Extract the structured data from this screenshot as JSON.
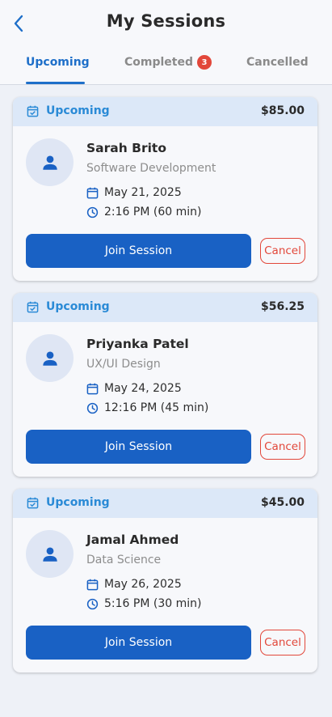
{
  "header": {
    "title": "My Sessions",
    "back_icon": "chevron-left-icon"
  },
  "tabs": [
    {
      "label": "Upcoming",
      "active": true
    },
    {
      "label": "Completed",
      "badge": "3"
    },
    {
      "label": "Cancelled"
    }
  ],
  "colors": {
    "accent": "#1961c4",
    "status_blue": "#2a8ad6",
    "cancel_red": "#e2473a",
    "card_header_bg": "#dce8f8"
  },
  "sessions": [
    {
      "status": "Upcoming",
      "price": "$85.00",
      "name": "Sarah Brito",
      "subject": "Software Development",
      "date": "May 21, 2025",
      "time": "2:16 PM (60 min)",
      "join_label": "Join Session",
      "cancel_label": "Cancel"
    },
    {
      "status": "Upcoming",
      "price": "$56.25",
      "name": "Priyanka Patel",
      "subject": "UX/UI Design",
      "date": "May 24, 2025",
      "time": "12:16 PM (45 min)",
      "join_label": "Join Session",
      "cancel_label": "Cancel"
    },
    {
      "status": "Upcoming",
      "price": "$45.00",
      "name": "Jamal Ahmed",
      "subject": "Data Science",
      "date": "May 26, 2025",
      "time": "5:16 PM (30 min)",
      "join_label": "Join Session",
      "cancel_label": "Cancel"
    }
  ]
}
